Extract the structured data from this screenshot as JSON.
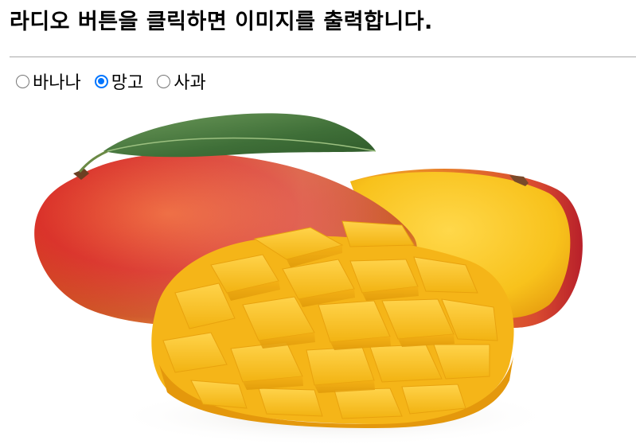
{
  "title": "라디오 버튼을 클릭하면 이미지를 출력합니다.",
  "radios": [
    {
      "label": "바나나",
      "checked": false
    },
    {
      "label": "망고",
      "checked": true
    },
    {
      "label": "사과",
      "checked": false
    }
  ],
  "colors": {
    "radio_accent": "#0075ff",
    "divider": "#a9a9a9"
  },
  "image": {
    "subject": "mango-image"
  }
}
